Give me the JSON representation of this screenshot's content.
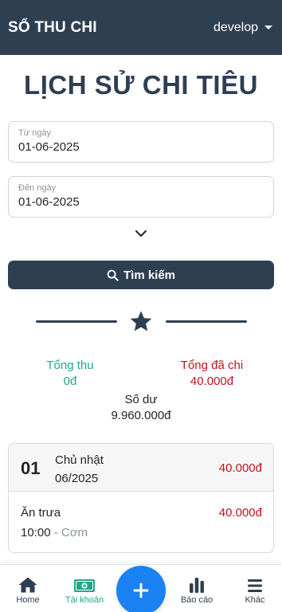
{
  "navbar": {
    "brand": "SỔ THU CHI",
    "user": "develop"
  },
  "page": {
    "title": "LỊCH SỬ CHI TIÊU"
  },
  "filters": {
    "from_label": "Từ ngày",
    "from_value": "01-06-2025",
    "to_label": "Đến ngày",
    "to_value": "01-06-2025",
    "search_label": "Tìm kiếm"
  },
  "summary": {
    "income_label": "Tổng thu",
    "income_value": "0đ",
    "expense_label": "Tổng đã chi",
    "expense_value": "40.000đ",
    "balance_label": "Số dư",
    "balance_value": "9.960.000đ"
  },
  "days": [
    {
      "day": "01",
      "weekday": "Chủ nhật",
      "month_year": "06/2025",
      "total": "40.000đ",
      "entries": [
        {
          "name": "Ăn trưa",
          "amount": "40.000đ",
          "time": "10:00",
          "separator": "-",
          "category": "Cơm"
        }
      ]
    }
  ],
  "bottom_nav": {
    "home": "Home",
    "account": "Tài khoản",
    "report": "Báo cáo",
    "more": "Khác",
    "active": "account"
  },
  "colors": {
    "primary": "#2f3f52",
    "income": "#1fa78a",
    "expense": "#c0141d",
    "fab": "#1a82f2"
  },
  "icons": [
    "caret-down-icon",
    "chevron-down-icon",
    "search-icon",
    "star-icon",
    "home-icon",
    "money-icon",
    "plus-icon",
    "bar-chart-icon",
    "menu-icon"
  ]
}
